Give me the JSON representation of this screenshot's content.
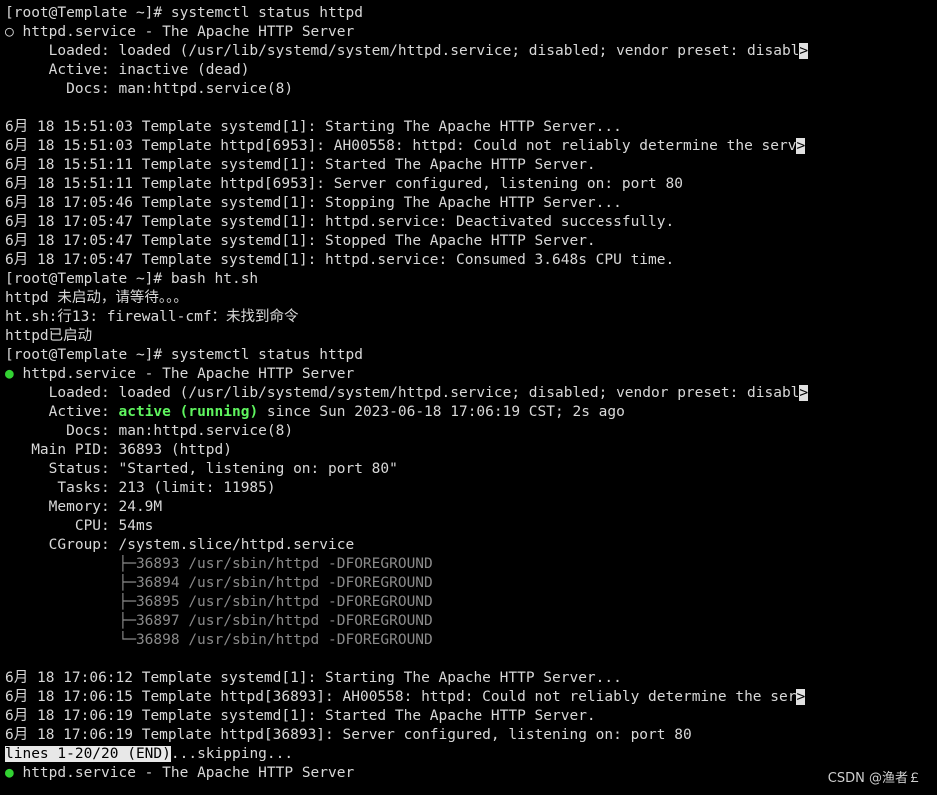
{
  "terminal": {
    "truncation_marker": ">",
    "lines": [
      {
        "text": "[root@Template ~]# systemctl status httpd"
      },
      {
        "text": "httpd.service - The Apache HTTP Server",
        "dot": "○"
      },
      {
        "text": "     Loaded: loaded (/usr/lib/systemd/system/httpd.service; disabled; vendor preset: disabl",
        "truncated": true
      },
      {
        "text": "     Active: inactive (dead)"
      },
      {
        "text": "       Docs: man:httpd.service(8)"
      },
      {
        "text": ""
      },
      {
        "text": "6月 18 15:51:03 Template systemd[1]: Starting The Apache HTTP Server..."
      },
      {
        "text": "6月 18 15:51:03 Template httpd[6953]: AH00558: httpd: Could not reliably determine the serv",
        "truncated": true
      },
      {
        "text": "6月 18 15:51:11 Template systemd[1]: Started The Apache HTTP Server."
      },
      {
        "text": "6月 18 15:51:11 Template httpd[6953]: Server configured, listening on: port 80"
      },
      {
        "text": "6月 18 17:05:46 Template systemd[1]: Stopping The Apache HTTP Server..."
      },
      {
        "text": "6月 18 17:05:47 Template systemd[1]: httpd.service: Deactivated successfully."
      },
      {
        "text": "6月 18 17:05:47 Template systemd[1]: Stopped The Apache HTTP Server."
      },
      {
        "text": "6月 18 17:05:47 Template systemd[1]: httpd.service: Consumed 3.648s CPU time."
      },
      {
        "text": "[root@Template ~]# bash ht.sh"
      },
      {
        "text": "httpd 未启动，请等待。。。"
      },
      {
        "text": "ht.sh:行13: firewall-cmf：未找到命令"
      },
      {
        "text": "httpd已启动"
      },
      {
        "text": "[root@Template ~]# systemctl status httpd"
      },
      {
        "text": "httpd.service - The Apache HTTP Server",
        "dot": "●",
        "dot_color": "green"
      },
      {
        "text": "     Loaded: loaded (/usr/lib/systemd/system/httpd.service; disabled; vendor preset: disabl",
        "truncated": true
      },
      {
        "prefix": "     Active: ",
        "highlight": "active (running)",
        "suffix": " since Sun 2023-06-18 17:06:19 CST; 2s ago"
      },
      {
        "text": "       Docs: man:httpd.service(8)"
      },
      {
        "text": "   Main PID: 36893 (httpd)"
      },
      {
        "text": "     Status: \"Started, listening on: port 80\""
      },
      {
        "text": "      Tasks: 213 (limit: 11985)"
      },
      {
        "text": "     Memory: 24.9M"
      },
      {
        "text": "        CPU: 54ms"
      },
      {
        "text": "     CGroup: /system.slice/httpd.service"
      },
      {
        "text": "             ├─36893 /usr/sbin/httpd -DFOREGROUND",
        "style": "gray"
      },
      {
        "text": "             ├─36894 /usr/sbin/httpd -DFOREGROUND",
        "style": "gray"
      },
      {
        "text": "             ├─36895 /usr/sbin/httpd -DFOREGROUND",
        "style": "gray"
      },
      {
        "text": "             ├─36897 /usr/sbin/httpd -DFOREGROUND",
        "style": "gray"
      },
      {
        "text": "             └─36898 /usr/sbin/httpd -DFOREGROUND",
        "style": "gray"
      },
      {
        "text": ""
      },
      {
        "text": "6月 18 17:06:12 Template systemd[1]: Starting The Apache HTTP Server..."
      },
      {
        "text": "6月 18 17:06:15 Template httpd[36893]: AH00558: httpd: Could not reliably determine the ser",
        "truncated": true
      },
      {
        "text": "6月 18 17:06:19 Template systemd[1]: Started The Apache HTTP Server."
      },
      {
        "text": "6月 18 17:06:19 Template httpd[36893]: Server configured, listening on: port 80"
      },
      {
        "pager": "lines 1-20/20 (END)",
        "suffix": "...skipping..."
      },
      {
        "text": "httpd.service - The Apache HTTP Server",
        "dot": "●",
        "dot_color": "green"
      }
    ]
  },
  "watermark": "CSDN @渔者￡",
  "colors": {
    "background": "#000000",
    "foreground": "#d8d8d8",
    "green": "#32d232",
    "active_green": "#5ff55f",
    "gray": "#8a8a8a"
  }
}
